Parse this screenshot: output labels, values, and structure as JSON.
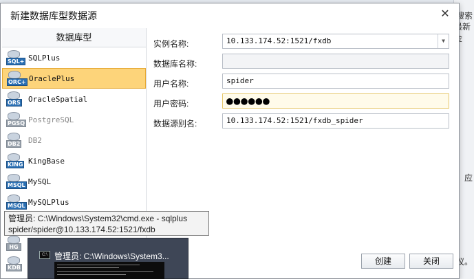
{
  "background": {
    "right_texts": [
      "搜索",
      "最新金",
      "应",
      "议。"
    ]
  },
  "dialog": {
    "title": "新建数据库型数据源",
    "close_glyph": "✕"
  },
  "left_panel": {
    "header": "数据库型",
    "items": [
      {
        "label": "SQLPlus",
        "tag": "SQL+",
        "selected": false,
        "muted": false
      },
      {
        "label": "OraclePlus",
        "tag": "ORC+",
        "selected": true,
        "muted": false
      },
      {
        "label": "OracleSpatial",
        "tag": "ORS",
        "selected": false,
        "muted": false
      },
      {
        "label": "PostgreSQL",
        "tag": "PGSQ",
        "selected": false,
        "muted": true
      },
      {
        "label": "DB2",
        "tag": "DB2",
        "selected": false,
        "muted": true
      },
      {
        "label": "KingBase",
        "tag": "KING",
        "selected": false,
        "muted": false
      },
      {
        "label": "MySQL",
        "tag": "MSQL",
        "selected": false,
        "muted": false
      },
      {
        "label": "MySQLPlus",
        "tag": "MSQL",
        "selected": false,
        "muted": false
      },
      {
        "label": "",
        "tag": "",
        "selected": false,
        "muted": false
      },
      {
        "label": "",
        "tag": "HG",
        "selected": false,
        "muted": true
      },
      {
        "label": "",
        "tag": "KDB",
        "selected": false,
        "muted": true
      }
    ]
  },
  "form": {
    "instance_label": "实例名称:",
    "instance_value": "10.133.174.52:1521/fxdb",
    "dbname_label": "数据库名称:",
    "dbname_value": "",
    "user_label": "用户名称:",
    "user_value": "spider",
    "password_label": "用户密码:",
    "password_value": "●●●●●●",
    "alias_label": "数据源别名:",
    "alias_value": "10.133.174.52:1521/fxdb_spider"
  },
  "buttons": {
    "create": "创建",
    "close": "关闭"
  },
  "taskbar_tooltip": {
    "line1": "管理员: C:\\Windows\\System32\\cmd.exe - sqlplus",
    "line2": "spider/spider@10.133.174.52:1521/fxdb"
  },
  "thumbnail": {
    "title": "管理员: C:\\Windows\\System3..."
  },
  "colors": {
    "selected_bg": "#fdd47a",
    "selected_border": "#e6a935",
    "db_tag_blue": "#2a6fb3"
  }
}
